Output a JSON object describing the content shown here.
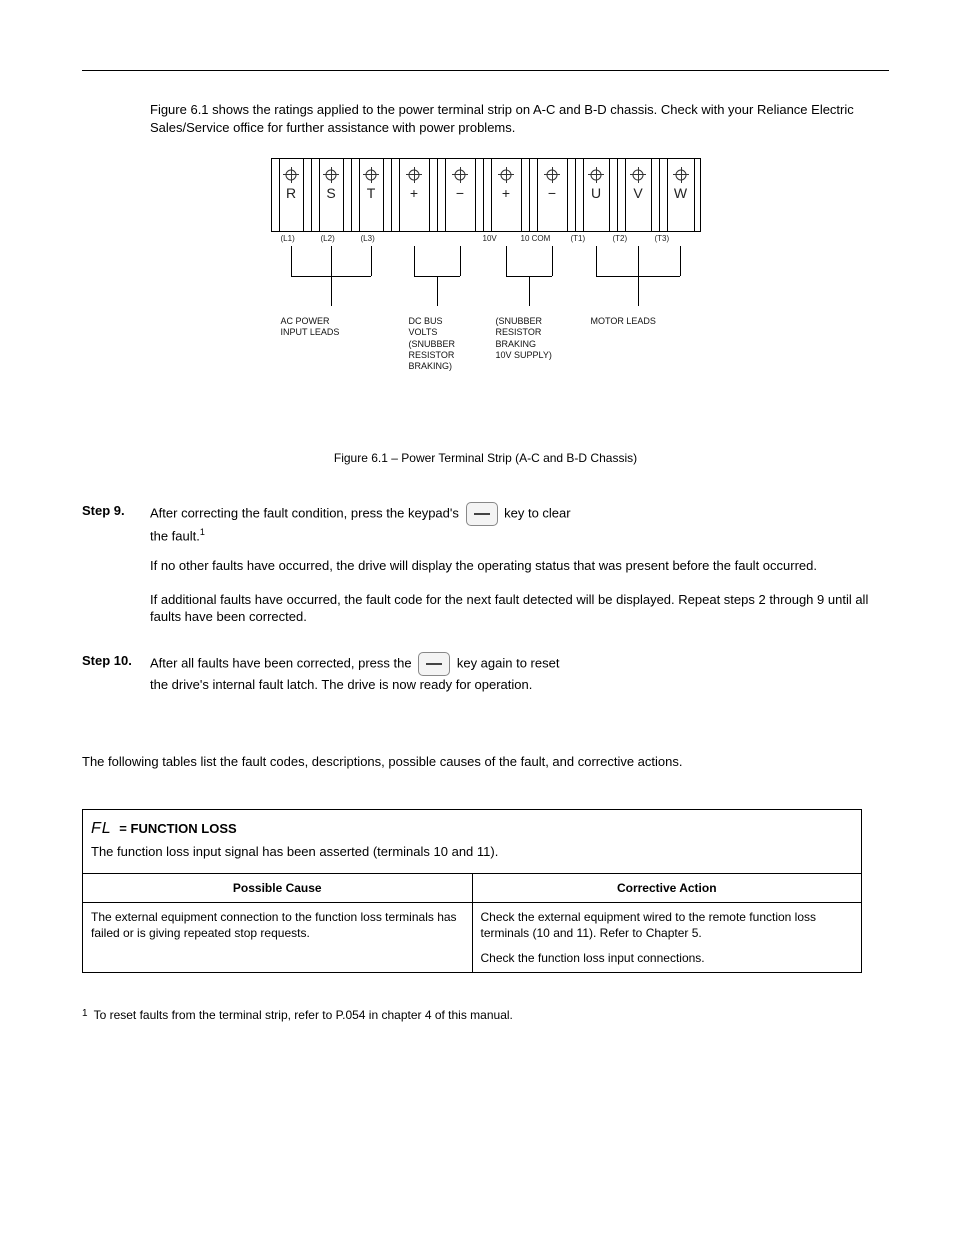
{
  "intro1": "Figure 6.1 shows the ratings applied to the power terminal strip on A-C and B-D chassis. Check with your Reliance Electric Sales/Service office for further assistance with power problems.",
  "figure_caption": "Figure 6.1 – Power Terminal Strip (A-C and B-D Chassis)",
  "terminals": {
    "R": "R",
    "S": "S",
    "T": "T",
    "P1": "+",
    "M1": "−",
    "P2": "+",
    "M2": "−",
    "U": "U",
    "V": "V",
    "W": "W"
  },
  "sublabels": {
    "L1": "(L1)",
    "L2": "(L2)",
    "L3": "(L3)",
    "V10": "10V",
    "C10": "10 COM",
    "T1": "(T1)",
    "T2": "(T2)",
    "T3": "(T3)"
  },
  "groups": {
    "ac": "AC POWER\nINPUT LEADS",
    "dc": "DC BUS\nVOLTS\n(SNUBBER\nRESISTOR\nBRAKING)",
    "snub": "(SNUBBER\nRESISTOR\nBRAKING\n10V SUPPLY)",
    "motor": "MOTOR LEADS"
  },
  "steps": {
    "s9_label": "Step 9.",
    "s9a": "After correcting the fault condition, press the keypad's",
    "s9b": "key to clear",
    "s9c": "the fault.",
    "sup1": "1",
    "s9_sub1": "If no other faults have occurred, the drive will display the operating status that was present before the fault occurred.",
    "s9_sub2": "If additional faults have occurred, the fault code for the next fault detected will be displayed. Repeat steps 2 through 9 until all faults have been corrected.",
    "s10_label": "Step 10.",
    "s10a": "After all faults have been corrected, press the",
    "s10b": "key again to reset",
    "s10c": "the drive's internal fault latch. The drive is now ready for operation."
  },
  "footnote": "To reset faults from the terminal strip, refer to P.054 in chapter 4 of this manual.",
  "section_intro": "The following tables list the fault codes, descriptions, possible causes of the fault, and corrective actions.",
  "fault": {
    "code": "FL",
    "name": "= FUNCTION LOSS",
    "desc": "The function loss input signal has been asserted (terminals 10 and 11).",
    "th_cause": "Possible Cause",
    "th_action": "Corrective Action",
    "cause": "The external equipment connection to the function loss terminals has failed or is giving repeated stop requests.",
    "action1": "Check the external equipment wired to the remote function loss terminals (10 and 11). Refer to Chapter 5.",
    "action2": "Check the function loss input connections."
  }
}
